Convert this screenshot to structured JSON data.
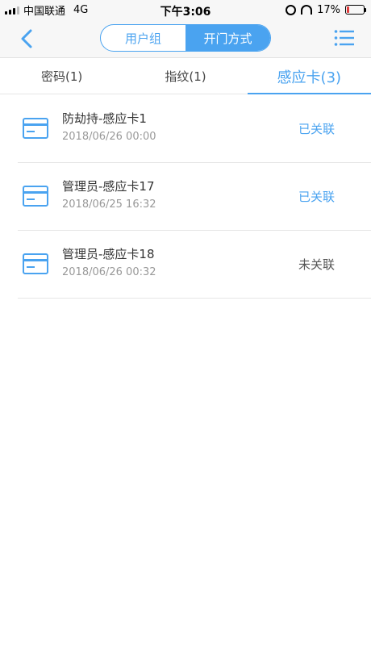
{
  "status_bar": {
    "carrier": "中国联通",
    "network": "4G",
    "time": "下午3:06",
    "battery_percent": "17%",
    "battery_level": 0.17
  },
  "nav": {
    "segments": [
      {
        "label": "用户组",
        "active": false
      },
      {
        "label": "开门方式",
        "active": true
      }
    ],
    "back_icon": "chevron-left-icon",
    "menu_icon": "list-menu-icon"
  },
  "tabs": [
    {
      "label": "密码(1)",
      "active": false
    },
    {
      "label": "指纹(1)",
      "active": false
    },
    {
      "label": "感应卡(3)",
      "active": true
    }
  ],
  "cards": [
    {
      "name": "防劫持-感应卡1",
      "date": "2018/06/26 00:00",
      "status": "已关联",
      "linked": true
    },
    {
      "name": "管理员-感应卡17",
      "date": "2018/06/25 16:32",
      "status": "已关联",
      "linked": true
    },
    {
      "name": "管理员-感应卡18",
      "date": "2018/06/26 00:32",
      "status": "未关联",
      "linked": false
    }
  ],
  "colors": {
    "accent": "#4aa3f0",
    "unlinked_text": "#555555",
    "battery_low": "#e03a3a"
  }
}
